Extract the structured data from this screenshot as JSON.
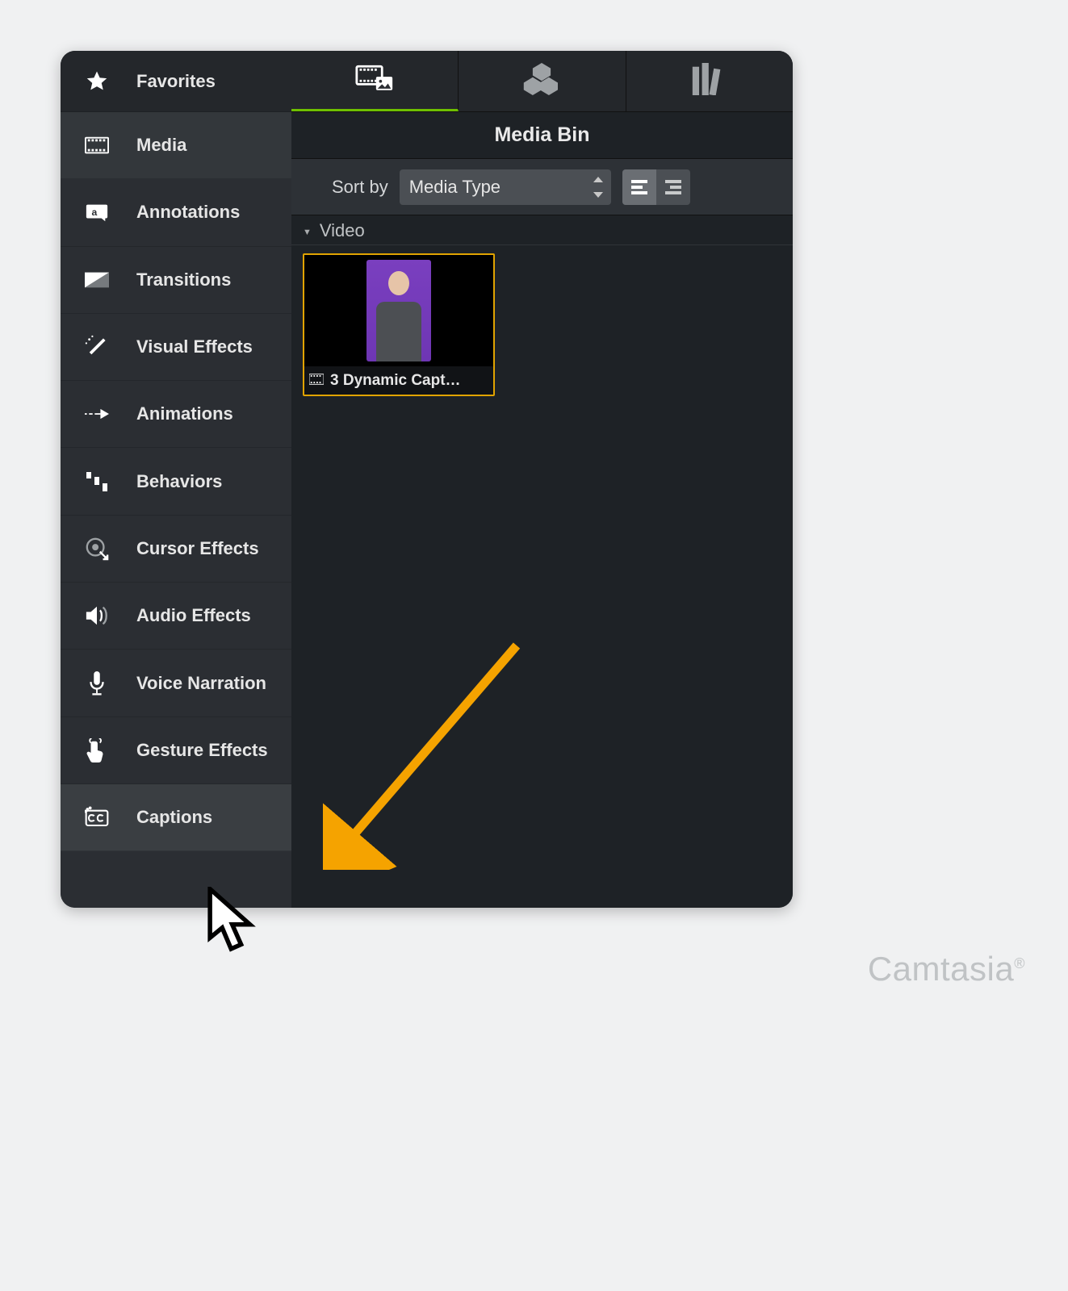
{
  "sidebar": {
    "items": [
      {
        "label": "Favorites",
        "icon": "star-icon"
      },
      {
        "label": "Media",
        "icon": "media-icon"
      },
      {
        "label": "Annotations",
        "icon": "annotation-icon"
      },
      {
        "label": "Transitions",
        "icon": "transition-icon"
      },
      {
        "label": "Visual Effects",
        "icon": "wand-icon"
      },
      {
        "label": "Animations",
        "icon": "arrow-right-icon"
      },
      {
        "label": "Behaviors",
        "icon": "bars-icon"
      },
      {
        "label": "Cursor Effects",
        "icon": "cursor-target-icon"
      },
      {
        "label": "Audio Effects",
        "icon": "speaker-icon"
      },
      {
        "label": "Voice Narration",
        "icon": "microphone-icon"
      },
      {
        "label": "Gesture Effects",
        "icon": "tap-icon"
      },
      {
        "label": "Captions",
        "icon": "cc-icon"
      }
    ]
  },
  "tabs": {
    "items": [
      {
        "icon": "media-bin-tab-icon",
        "active": true
      },
      {
        "icon": "assets-tab-icon",
        "active": false
      },
      {
        "icon": "library-tab-icon",
        "active": false
      }
    ]
  },
  "panel": {
    "title": "Media Bin",
    "sort_label": "Sort by",
    "sort_value": "Media Type",
    "section": "Video"
  },
  "clips": [
    {
      "name": "3 Dynamic Capt…"
    }
  ],
  "watermark": "Camtasia"
}
